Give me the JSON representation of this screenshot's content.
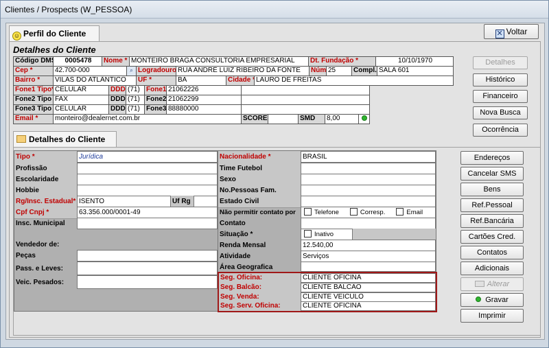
{
  "window": {
    "title": "Clientes / Prospects (W_PESSOA)"
  },
  "tabs": {
    "perfil": "Perfil do Cliente",
    "detalhes": "Detalhes do Cliente"
  },
  "buttons": {
    "voltar": "Voltar",
    "detalhes": "Detalhes",
    "historico": "Histórico",
    "financeiro": "Financeiro",
    "nova_busca": "Nova Busca",
    "ocorrencia": "Ocorrência",
    "enderecos": "Endereços",
    "cancelar_sms": "Cancelar SMS",
    "bens": "Bens",
    "ref_pessoal": "Ref.Pessoal",
    "ref_bancaria": "Ref.Bancária",
    "cartoes": "Cartões Cred.",
    "contatos": "Contatos",
    "adicionais": "Adicionais",
    "alterar": "Alterar",
    "gravar": "Gravar",
    "imprimir": "Imprimir"
  },
  "top": {
    "section_title": "Detalhes do Cliente",
    "labels": {
      "codigo": "Código DMS",
      "nome": "Nome *",
      "fundacao": "Dt. Fundação *",
      "cep": "Cep *",
      "logradouro": "Logradouro*",
      "num": "Núm*",
      "compl": "Compl.",
      "bairro": "Bairro *",
      "uf": "UF *",
      "cidade": "Cidade *",
      "fone1tipo": "Fone1 Tipo*",
      "ddd": "DDD",
      "fone1": "Fone1",
      "fone2tipo": "Fone2 Tipo",
      "fone2": "Fone2",
      "fone3tipo": "Fone3 Tipo",
      "fone3": "Fone3",
      "email": "Email *",
      "score": "SCORE",
      "smd": "SMD"
    },
    "values": {
      "codigo": "0005478",
      "nome": "MONTEIRO BRAGA CONSULTORIA EMPRESARIAL",
      "fundacao": "10/10/1970",
      "cep": "42.700-000",
      "logradouro": "RUA ANDRÉ LUIZ RIBEIRO DA FONTE",
      "num": "25",
      "compl": "SALA 601",
      "bairro": "VILAS DO ATLÂNTICO",
      "uf": "BA",
      "cidade": "LAURO DE FREITAS",
      "fone1tipo": "CELULAR",
      "ddd1": "(71)",
      "fone1": "21062226",
      "fone2tipo": "FAX",
      "ddd2": "(71)",
      "fone2": "21062299",
      "fone3tipo": "CELULAR",
      "ddd3": "(71)",
      "fone3": "88880000",
      "email": "monteiro@dealernet.com.br",
      "score": "",
      "smd": "8,00"
    }
  },
  "detalhes": {
    "left": {
      "tipo": "Tipo *",
      "tipo_val": "Jurídica",
      "profissao": "Profissão",
      "escolaridade": "Escolaridade",
      "hobbie": "Hobbie",
      "rg": "Rg/Insc. Estadual*",
      "rg_val": "ISENTO",
      "ufrg": "Uf Rg",
      "cpf": "Cpf Cnpj *",
      "cpf_val": "63.356.000/0001-49",
      "insc_mun": "Insc. Municipal",
      "vendedor": "Vendedor de:",
      "pecas": "Peças",
      "pass": "Pass. e Leves:",
      "veic": "Veic. Pesados:"
    },
    "right": {
      "nacionalidade": "Nacionalidade *",
      "nacionalidade_val": "BRASIL",
      "time": "Time Futebol",
      "sexo": "Sexo",
      "nopessoas": "No.Pessoas Fam.",
      "estado_civil": "Estado Civil",
      "nao_permitir": "Não permitir contato por",
      "telefone": "Telefone",
      "corresp": "Corresp.",
      "email": "Email",
      "contato": "Contato",
      "situacao": "Situação *",
      "inativo": "Inativo",
      "renda": "Renda Mensal",
      "renda_val": "12.540,00",
      "atividade": "Atividade",
      "atividade_val": "Serviços",
      "area": "Área Geografica",
      "seg_oficina": "Seg. Oficina:",
      "seg_oficina_val": "CLIENTE OFICINA",
      "seg_balcao": "Seg. Balcão:",
      "seg_balcao_val": "CLIENTE BALCÃO",
      "seg_venda": "Seg. Venda:",
      "seg_venda_val": "CLIENTE VEICULO",
      "seg_serv": "Seg. Serv. Oficina:",
      "seg_serv_val": "CLIENTE OFICINA"
    }
  },
  "colors": {
    "label_red": "#c00000",
    "window_bg": "#cfd8e2",
    "panel_bg": "#e3e3e3"
  },
  "icons": {
    "voltar": "close-x-icon",
    "perfil": "smiley-icon",
    "detalhes": "folder-icon",
    "gravar": "green-dot-icon",
    "alterar": "edit-icon"
  }
}
